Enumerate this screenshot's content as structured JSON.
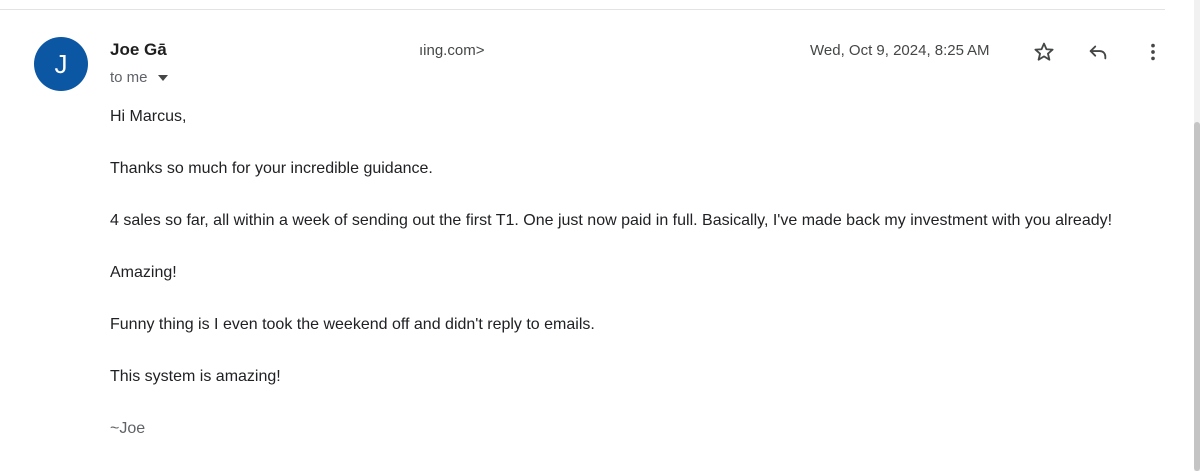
{
  "email": {
    "avatar_letter": "J",
    "sender_name": "Joe Gā",
    "sender_email_fragment": "ıing.com>",
    "recipient_text": "to me",
    "timestamp": "Wed, Oct 9, 2024, 8:25 AM",
    "body": {
      "greeting": "Hi Marcus,",
      "line1": "Thanks so much for your incredible guidance.",
      "line2": "4 sales so far, all within a week of sending out the first T1. One just now paid in full. Basically, I've made back my investment with you already!",
      "line3": "Amazing!",
      "line4": "Funny thing is I even took the weekend off and didn't reply to emails.",
      "line5": "This system is amazing!",
      "signoff": "~Joe"
    }
  },
  "icons": {
    "star": "star-icon",
    "reply": "reply-icon",
    "more": "more-vert-icon",
    "dropdown": "caret-down-icon"
  },
  "colors": {
    "avatar_bg": "#0b57a4",
    "text": "#202124",
    "muted": "#5f6368"
  }
}
